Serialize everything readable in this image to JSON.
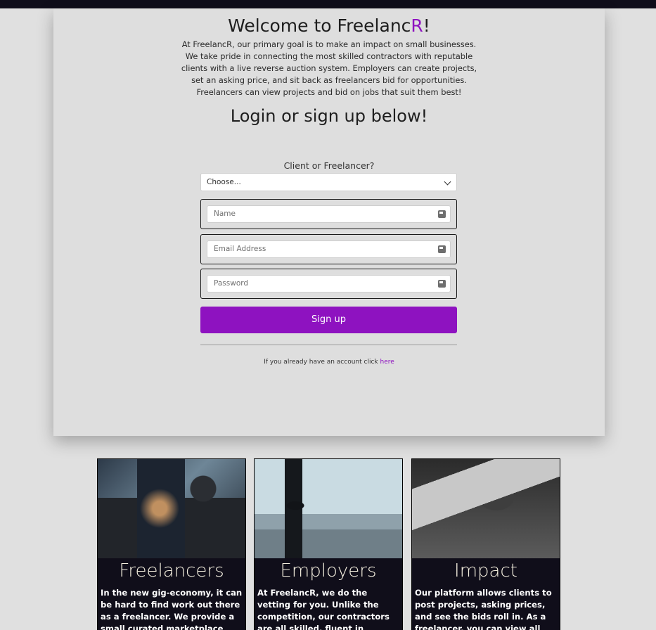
{
  "header": {
    "title_prefix": "Welcome to Freelanc",
    "title_accent": "R",
    "title_suffix": "!",
    "intro": "At FreelancR, our primary goal is to make an impact on small businesses. We take pride in connecting the most skilled contractors with reputable clients with a live reverse auction system. Employers can create projects, set an asking price, and sit back as freelancers bid for opportunities. Freelancers can view projects and bid on jobs that suit them best!",
    "subtitle": "Login or sign up below!"
  },
  "form": {
    "role_label": "Client or Freelancer?",
    "role_select": "Choose...",
    "name_placeholder": "Name",
    "email_placeholder": "Email Address",
    "password_placeholder": "Password",
    "signup_label": "Sign up",
    "login_note": "If you already have an account click",
    "login_link": "here"
  },
  "cards": [
    {
      "title": "Freelancers",
      "text": "In the new gig-economy, it can be hard to find work out there as a freelancer. We provide a small curated marketplace where your"
    },
    {
      "title": "Employers",
      "text": "At FreelancR, we do the vetting for you. Unlike the competition, our contractors are all skilled, fluent in english, and determined to build"
    },
    {
      "title": "Impact",
      "text": "Our platform allows clients to post projects, asking prices, and see the bids roll in. As a freelancer, you can view all available projects and bid"
    }
  ],
  "colors": {
    "accent": "#8e12c0",
    "topbar": "#0f0d1a",
    "card_bg": "#100e1a"
  }
}
